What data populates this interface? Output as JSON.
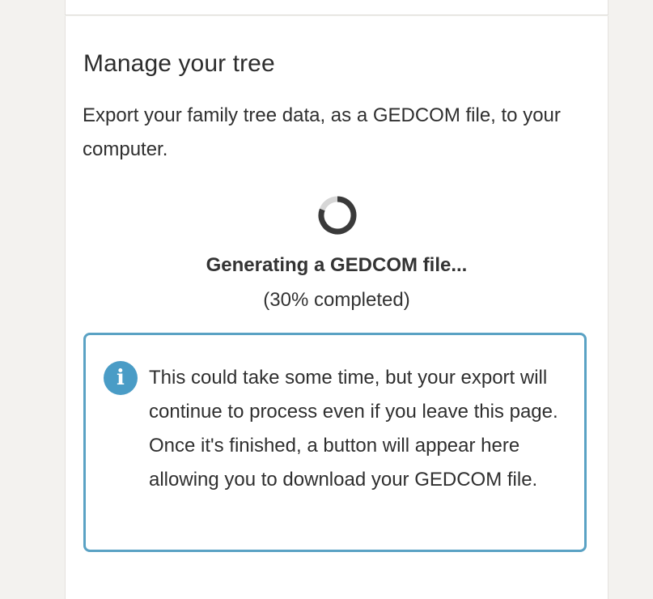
{
  "section": {
    "title": "Manage your tree",
    "description": "Export your family tree data, as a GEDCOM file, to your computer."
  },
  "progress": {
    "status_title": "Generating a GEDCOM file...",
    "status_detail": "(30% completed)",
    "percent_complete": 30,
    "spinner_icon": "loading-spinner-icon"
  },
  "info": {
    "icon": "info-icon",
    "icon_glyph": "i",
    "message": "This could take some time, but your export will continue to process even if you leave this page. Once it's finished, a button will appear here allowing you to download your GEDCOM file.",
    "accent_color": "#5aa2c4"
  }
}
